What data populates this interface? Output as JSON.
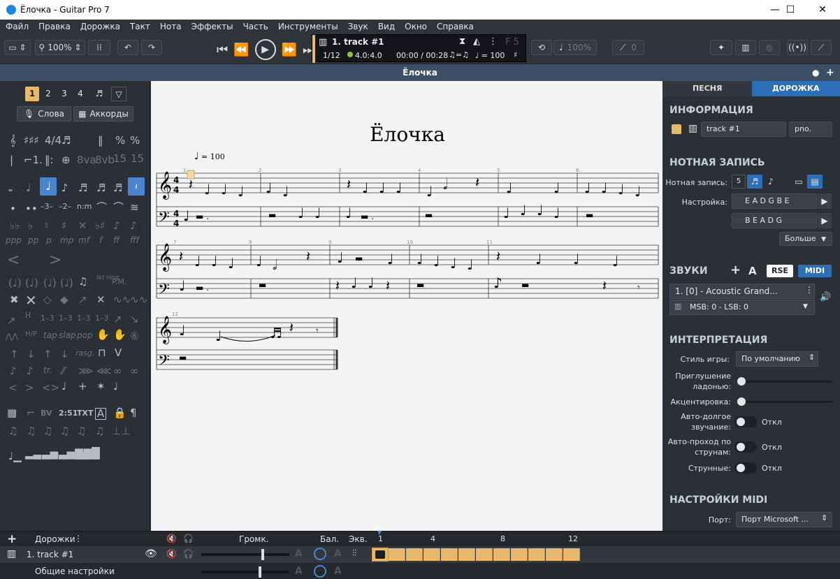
{
  "window": {
    "title": "Ёлочка - Guitar Pro 7",
    "minimize": "—",
    "maximize": "☐",
    "close": "✕"
  },
  "menu": [
    "Файл",
    "Правка",
    "Дорожка",
    "Такт",
    "Нота",
    "Эффекты",
    "Часть",
    "Инструменты",
    "Звук",
    "Вид",
    "Окно",
    "Справка"
  ],
  "toolbar": {
    "zoom": "100%",
    "speed": "100%",
    "pitch": "0"
  },
  "lcd": {
    "track": "1. track #1",
    "bar_position": "1/12",
    "time_signature": "4.0:4.0",
    "time": "00:00 / 00:28",
    "triplet_feel": "♫=♫",
    "tempo_label": "♩ = 100",
    "key": "F 5"
  },
  "document": {
    "tab_title": "Ёлочка"
  },
  "left_panel": {
    "voices": [
      "1",
      "2",
      "3",
      "4"
    ],
    "lyrics_button": "Слова",
    "chords_button": "Аккорды"
  },
  "score": {
    "title": "Ёлочка",
    "tempo": "= 100",
    "bar_numbers": [
      "1",
      "2",
      "3",
      "4",
      "5",
      "6",
      "7",
      "8",
      "9",
      "10",
      "11",
      "12"
    ],
    "time_sig": "4"
  },
  "right_panel": {
    "tabs": [
      "ПЕСНЯ",
      "ДОРОЖКА"
    ],
    "info_header": "ИНФОРМАЦИЯ",
    "track_name": "track #1",
    "track_short": "pno.",
    "notation_header": "НОТНАЯ ЗАПИСЬ",
    "notation_label": "Нотная запись:",
    "tuning_label": "Настройка:",
    "tuning_1": "E A D G B E",
    "tuning_2": "B E A D G",
    "more_button": "Больше",
    "sounds_header": "ЗВУКИ",
    "rse_button": "RSE",
    "midi_button": "MIDI",
    "a_button": "A",
    "sound_name": "1. [0] - Acoustic Grand...",
    "msb_lsb": "MSB: 0 - LSB: 0",
    "interpretation_header": "ИНТЕРПРЕТАЦИЯ",
    "play_style_label": "Стиль игры:",
    "play_style_value": "По умолчанию",
    "palm_mute_label_1": "Приглушение",
    "palm_mute_label_2": "ладонью:",
    "accent_label": "Акцентировка:",
    "auto_sustain_label_1": "Авто-долгое",
    "auto_sustain_label_2": "звучание:",
    "auto_sustain_value": "Откл",
    "auto_string_label_1": "Авто-проход по",
    "auto_string_label_2": "струнам:",
    "auto_string_value": "Откл",
    "strings_label": "Струнные:",
    "strings_value": "Откл",
    "midi_header": "НАСТРОЙКИ MIDI",
    "port_label": "Порт:",
    "port_value": "Порт Microsoft ..."
  },
  "bottom": {
    "tracks_label": "Дорожки",
    "volume_label": "Громк.",
    "balance_label": "Бал.",
    "eq_label": "Экв.",
    "track_row": "1. track #1",
    "master_row": "Общие настройки",
    "timeline_numbers": [
      "1",
      "4",
      "8",
      "12"
    ]
  },
  "colors": {
    "accent": "#e8b86c",
    "selected_tab": "#2d6fb7",
    "doc_bar": "#3d4f66"
  }
}
